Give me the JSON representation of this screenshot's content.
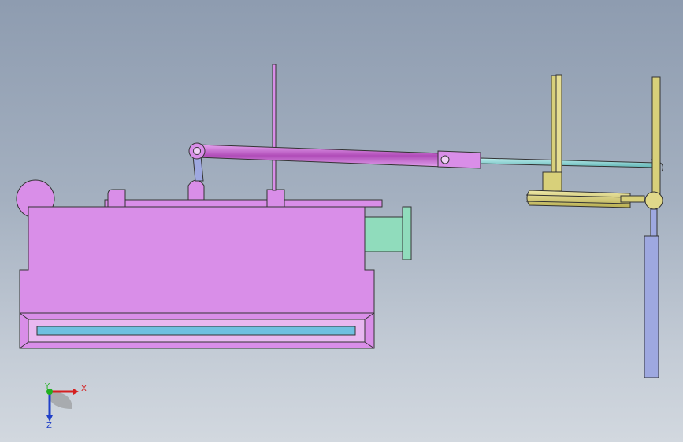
{
  "triad": {
    "x_label": "X",
    "y_label": "Y",
    "z_label": "Z",
    "x_color": "#d42020",
    "y_color": "#20b020",
    "z_color": "#2040c8"
  },
  "colors": {
    "housing": "#d98ee8",
    "slot": "#6fc0e0",
    "flange": "#90dcbc",
    "rod_cyan": "#8fd8d8",
    "yellow_part": "#d8d07a",
    "blue_link": "#9ea8e0",
    "outline": "#333333"
  }
}
